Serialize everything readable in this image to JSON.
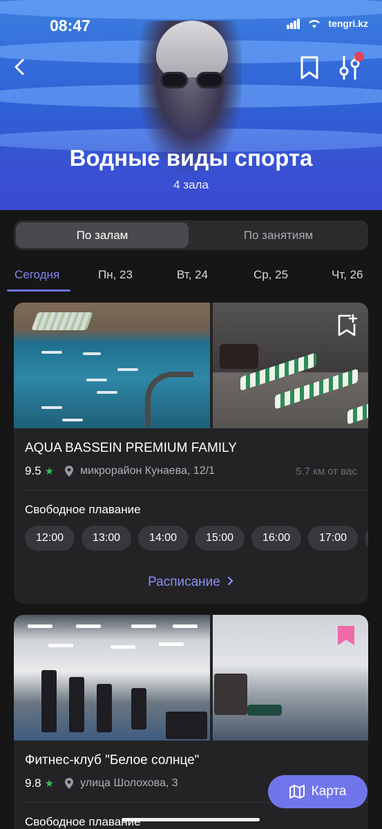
{
  "status_bar": {
    "time": "08:47",
    "watermark": "tengri.kz"
  },
  "header": {
    "title": "Водные виды спорта",
    "subtitle": "4 зала"
  },
  "segmented": {
    "active": "По залам",
    "inactive": "По занятиям"
  },
  "date_tabs": [
    "Сегодня",
    "Пн, 23",
    "Вт, 24",
    "Ср, 25",
    "Чт, 26"
  ],
  "cards": [
    {
      "name": "AQUA BASSEIN PREMIUM FAMILY",
      "rating": "9.5",
      "address": "микрорайон Кунаева, 12/1",
      "distance": "5.7 км от вас",
      "activity": "Свободное плавание",
      "slots": [
        "12:00",
        "13:00",
        "14:00",
        "15:00",
        "16:00",
        "17:00"
      ],
      "schedule_label": "Расписание"
    },
    {
      "name": "Фитнес-клуб \"Белое солнце\"",
      "rating": "9.8",
      "address": "улица Шолохова, 3",
      "activity": "Свободное плавание"
    }
  ],
  "map_button": {
    "label": "Карта"
  },
  "colors": {
    "accent": "#7076ea",
    "star": "#34c05a",
    "saved": "#f06aa8",
    "notification": "#e3445a"
  },
  "icons": [
    "back-arrow-icon",
    "bookmark-icon",
    "filter-icon",
    "bookmark-add-icon",
    "star-icon",
    "location-pin-icon",
    "chevron-right-icon",
    "map-icon"
  ]
}
